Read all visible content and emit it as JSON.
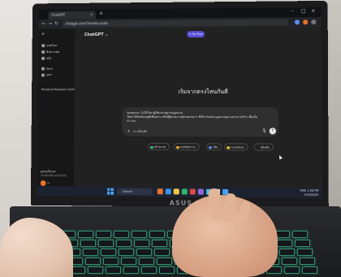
{
  "browser": {
    "tab_title": "ChatGPT",
    "tab_close": "×",
    "new_tab": "+",
    "url": "chatgpt.com/?model=auto",
    "window_controls": [
      "–",
      "□",
      "×"
    ],
    "nav_icons": [
      "←",
      "→",
      "↻"
    ]
  },
  "sidebar": {
    "items": [
      {
        "label": "แชทใหม่"
      },
      {
        "label": "ค้นหาแชท"
      },
      {
        "label": "คลัง"
      },
      {
        "label": "Sora"
      },
      {
        "label": "GPT"
      }
    ],
    "section_label": "Personal Request Clarification",
    "footer_label": "ดูแผนทั้งหมด",
    "footer_sub": "ปลดล็อกฟีเจอร์เพิ่มเติม",
    "avatar_label": "ผ"
  },
  "main": {
    "model_selector": "ChatGPT ⌄",
    "plus_button": "✦ รับ Plus",
    "heading": "เริ่มจากตรงไหนกันดี",
    "composer_lines": [
      "คุณคอนนะ ไม่ได้ไปหาผู้เชี่ยวชาญด้านกฎหมาย",
      "Task ให้ซับซ้อนอยู่ดีเสียอย่าง หรือมีผู้ทรงความรู้ช่วยผ่านการ ที่เกี่ยวข้องกับกฎหมายคุณ อย่างการสร้าง เพื่อเป็น",
      "ถ้า ออง"
    ],
    "composer_plus": "+",
    "composer_tools": "⇆ เครื่องมือ",
    "mic": "🎙",
    "send": "↑",
    "chips": [
      {
        "label": "สร้างภาพ",
        "color": "#3db36b"
      },
      {
        "label": "สรุปข้อความ",
        "color": "#e3a531"
      },
      {
        "label": "โค้ด",
        "color": "#5b8ef0"
      },
      {
        "label": "ระดมสมอง",
        "color": "#e8c23a"
      },
      {
        "label": "เพิ่มเติม",
        "color": "#8a8a8a"
      }
    ]
  },
  "taskbar": {
    "search_label": "Search",
    "tray_lines": [
      "ENG  1:58 PM",
      "21/4/2025"
    ],
    "app_colors": [
      "#e8742c",
      "#3a8ee6",
      "#f2c744",
      "#2fb36c",
      "#d94a4a",
      "#8e6bd8",
      "#45b4e6",
      "#e0e0e0",
      "#4aa3f0"
    ]
  },
  "laptop": {
    "brand": "ASUS"
  },
  "colors": {
    "accent": "#5a4fd6",
    "keyboard_glow": "#2f8f6e"
  }
}
